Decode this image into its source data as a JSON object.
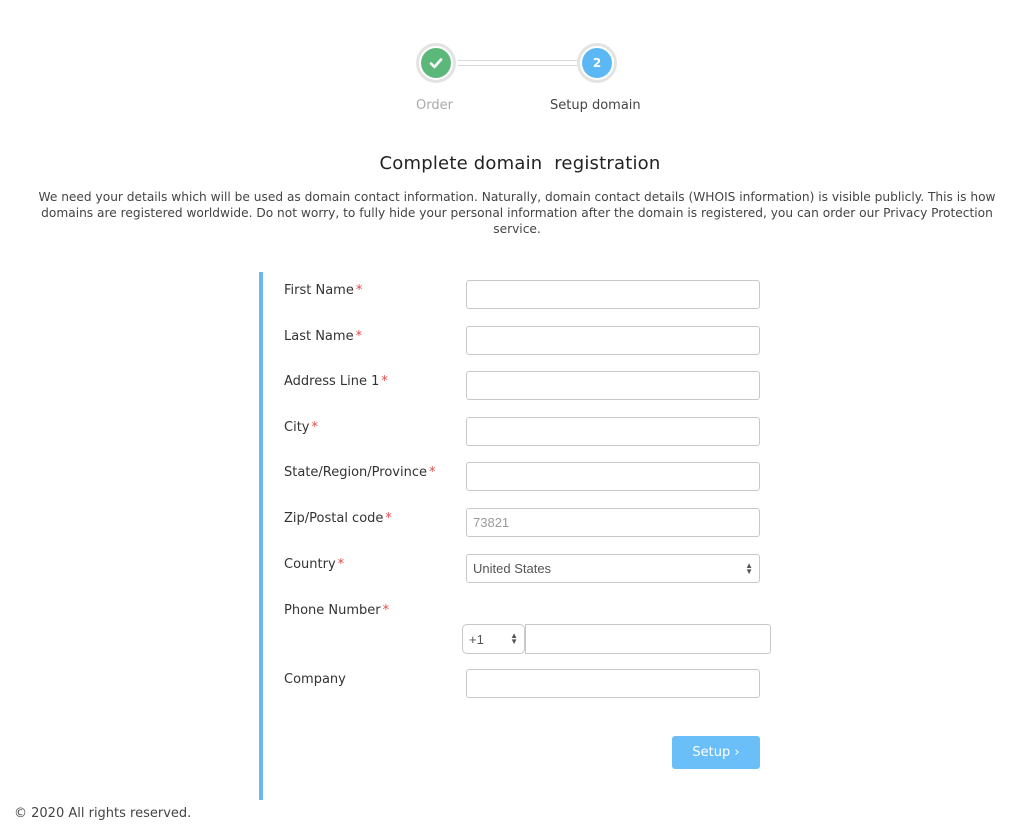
{
  "stepper": {
    "steps": [
      {
        "label": "Order",
        "status": "complete",
        "icon": "check-icon",
        "color": "#5cb87a"
      },
      {
        "label": "Setup domain",
        "status": "current",
        "number": "2",
        "color": "#5bb8f5"
      }
    ]
  },
  "page": {
    "title": "Complete domain  registration",
    "intro": "We need your details which will be used as domain contact information. Naturally, domain contact details (WHOIS information) is visible publicly. This is how domains are registered worldwide. Do not worry, to fully hide your personal information after the domain is registered, you can order our Privacy Protection service."
  },
  "form": {
    "required_marker": "*",
    "fields": {
      "first_name": {
        "label": "First Name",
        "required": true,
        "value": "",
        "placeholder": ""
      },
      "last_name": {
        "label": "Last Name",
        "required": true,
        "value": "",
        "placeholder": ""
      },
      "address_line_1": {
        "label": "Address Line 1",
        "required": true,
        "value": "",
        "placeholder": ""
      },
      "city": {
        "label": "City",
        "required": true,
        "value": "",
        "placeholder": ""
      },
      "state": {
        "label": "State/Region/Province",
        "required": true,
        "value": "",
        "placeholder": ""
      },
      "zip": {
        "label": "Zip/Postal code",
        "required": true,
        "value": "",
        "placeholder": "73821"
      },
      "country": {
        "label": "Country",
        "required": true,
        "selected": "United States"
      },
      "phone": {
        "label": "Phone Number",
        "required": true,
        "code": "+1",
        "value": ""
      },
      "company": {
        "label": "Company",
        "required": false,
        "value": "",
        "placeholder": ""
      }
    },
    "submit_label": "Setup ›",
    "accent_color": "#6ab8f0"
  },
  "footer": {
    "copyright": "© 2020 All rights reserved."
  }
}
